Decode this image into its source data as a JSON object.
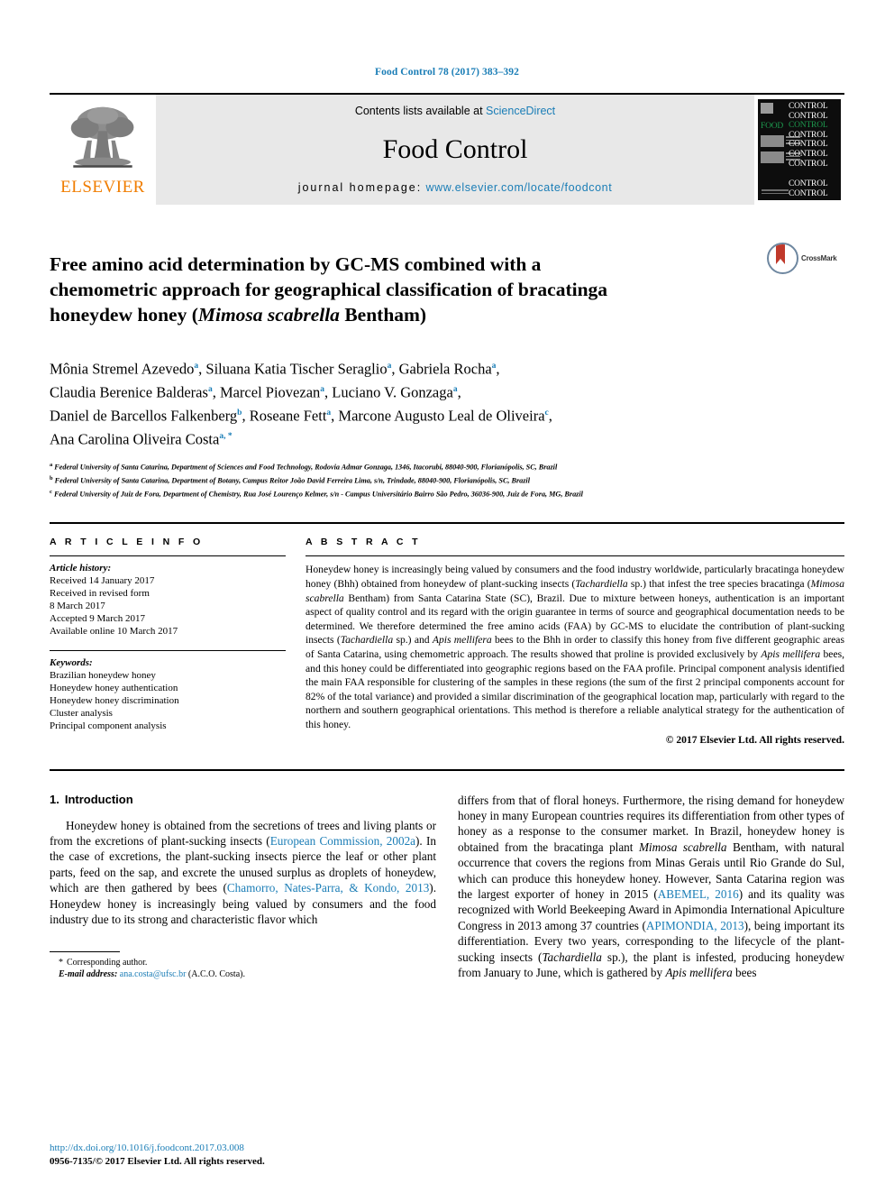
{
  "running_head": "Food Control 78 (2017) 383–392",
  "banner": {
    "publisher_name": "ELSEVIER",
    "publisher_logo_icon": "elsevier-tree-icon",
    "contents_prefix": "Contents lists available at",
    "contents_link": "ScienceDirect",
    "journal_name": "Food Control",
    "homepage_label": "journal homepage:",
    "homepage_url": "www.elsevier.com/locate/foodcont",
    "cover": {
      "repeat_word": "CONTROL",
      "accent_word": "FOOD",
      "accent_color": "#1d9a4e",
      "background": "#0d0d0d"
    }
  },
  "title": {
    "line1": "Free amino acid determination by GC-MS combined with a",
    "line2": "chemometric approach for geographical classification of bracatinga",
    "line3_pre": "honeydew honey (",
    "line3_italic": "Mimosa scabrella",
    "line3_post": " Bentham)"
  },
  "crossmark": {
    "label": "CrossMark",
    "icon": "crossmark-icon"
  },
  "authors": [
    {
      "name": "Mônia Stremel Azevedo",
      "sup": "a",
      "sep": ", "
    },
    {
      "name": "Siluana Katia Tischer Seraglio",
      "sup": "a",
      "sep": ", "
    },
    {
      "name": "Gabriela Rocha",
      "sup": "a",
      "sep": ","
    },
    {
      "name": "Claudia Berenice Balderas",
      "sup": "a",
      "sep": ", "
    },
    {
      "name": "Marcel Piovezan",
      "sup": "a",
      "sep": ", "
    },
    {
      "name": "Luciano V. Gonzaga",
      "sup": "a",
      "sep": ","
    },
    {
      "name": "Daniel de Barcellos Falkenberg",
      "sup": "b",
      "sep": ", "
    },
    {
      "name": "Roseane Fett",
      "sup": "a",
      "sep": ", "
    },
    {
      "name": "Marcone Augusto Leal de Oliveira",
      "sup": "c",
      "sep": ","
    },
    {
      "name": "Ana Carolina Oliveira Costa",
      "sup": "a, *",
      "sep": ""
    }
  ],
  "author_lines": [
    "Mônia Stremel Azevedo a, Siluana Katia Tischer Seraglio a, Gabriela Rocha a,",
    "Claudia Berenice Balderas a, Marcel Piovezan a, Luciano V. Gonzaga a,",
    "Daniel de Barcellos Falkenberg b, Roseane Fett a, Marcone Augusto Leal de Oliveira c,",
    "Ana Carolina Oliveira Costa a, *"
  ],
  "affiliations": [
    {
      "mark": "a",
      "text": "Federal University of Santa Catarina, Department of Sciences and Food Technology, Rodovia Admar Gonzaga, 1346, Itacorubi, 88040-900, Florianópolis, SC, Brazil"
    },
    {
      "mark": "b",
      "text": "Federal University of Santa Catarina, Department of Botany, Campus Reitor João David Ferreira Lima, s/n, Trindade, 88040-900, Florianópolis, SC, Brazil"
    },
    {
      "mark": "c",
      "text": "Federal University of Juiz de Fora, Department of Chemistry, Rua José Lourenço Kelmer, s/n - Campus Universitário Bairro São Pedro, 36036-900, Juiz de Fora, MG, Brazil"
    }
  ],
  "article_info": {
    "heading": "A R T I C L E  I N F O",
    "history_label": "Article history:",
    "history": [
      "Received 14 January 2017",
      "Received in revised form",
      "8 March 2017",
      "Accepted 9 March 2017",
      "Available online 10 March 2017"
    ],
    "keywords_label": "Keywords:",
    "keywords": [
      "Brazilian honeydew honey",
      "Honeydew honey authentication",
      "Honeydew honey discrimination",
      "Cluster analysis",
      "Principal component analysis"
    ]
  },
  "abstract": {
    "heading": "A B S T R A C T",
    "part1": "Honeydew honey is increasingly being valued by consumers and the food industry worldwide, particularly bracatinga honeydew honey (Bhh) obtained from honeydew of plant-sucking insects (",
    "sp1": "Tachardiella",
    "part2": " sp.) that infest the tree species bracatinga (",
    "sp2": "Mimosa scabrella",
    "part3": " Bentham) from Santa Catarina State (SC), Brazil. Due to mixture between honeys, authentication is an important aspect of quality control and its regard with the origin guarantee in terms of source and geographical documentation needs to be determined. We therefore determined the free amino acids (FAA) by GC-MS to elucidate the contribution of plant-sucking insects (",
    "sp3": "Tachardiella",
    "part4": " sp.) and ",
    "sp4": "Apis mellifera",
    "part5": " bees to the Bhh in order to classify this honey from five different geographic areas of Santa Catarina, using chemometric approach. The results showed that proline is provided exclusively by ",
    "sp5": "Apis mellifera",
    "part6": " bees, and this honey could be differentiated into geographic regions based on the FAA profile. Principal component analysis identified the main FAA responsible for clustering of the samples in these regions (the sum of the first 2 principal components account for 82% of the total variance) and provided a similar discrimination of the geographical location map, particularly with regard to the northern and southern geographical orientations. This method is therefore a reliable analytical strategy for the authentication of this honey.",
    "copyright": "© 2017 Elsevier Ltd. All rights reserved."
  },
  "intro": {
    "number": "1.",
    "heading": "Introduction",
    "left_p1_a": "Honeydew honey is obtained from the secretions of trees and living plants or from the excretions of plant-sucking insects (",
    "left_ref1": "European Commission, 2002a",
    "left_p1_b": "). In the case of excretions, the plant-sucking insects pierce the leaf or other plant parts, feed on the sap, and excrete the unused surplus as droplets of honeydew, which are then gathered by bees (",
    "left_ref2": "Chamorro, Nates-Parra, & Kondo, 2013",
    "left_p1_c": "). Honeydew honey is increasingly being valued by consumers and the food industry due to its strong and characteristic flavor which",
    "right_p1_a": "differs from that of floral honeys. Furthermore, the rising demand for honeydew honey in many European countries requires its differentiation from other types of honey as a response to the consumer market. In Brazil, honeydew honey is obtained from the bracatinga plant ",
    "right_sp1": "Mimosa scabrella",
    "right_p1_b": " Bentham, with natural occurrence that covers the regions from Minas Gerais until Rio Grande do Sul, which can produce this honeydew honey. However, Santa Catarina region was the largest exporter of honey in 2015 (",
    "right_ref1": "ABEMEL, 2016",
    "right_p1_c": ") and its quality was recognized with World Beekeeping Award in Apimondia International Apiculture Congress in 2013 among 37 countries (",
    "right_ref2": "APIMONDIA, 2013",
    "right_p1_d": "), being important its differentiation. Every two years, corresponding to the lifecycle of the plant-sucking insects (",
    "right_sp2": "Tachardiella",
    "right_p1_e": " sp.), the plant is infested, producing honeydew from January to June, which is gathered by ",
    "right_sp3": "Apis mellifera",
    "right_p1_f": " bees"
  },
  "footnote": {
    "star": "*",
    "corresponding": "Corresponding author.",
    "email_label": "E-mail address:",
    "email": "ana.costa@ufsc.br",
    "email_owner": "(A.C.O. Costa)."
  },
  "page_footer": {
    "doi": "http://dx.doi.org/10.1016/j.foodcont.2017.03.008",
    "issn_line": "0956-7135/© 2017 Elsevier Ltd. All rights reserved."
  },
  "colors": {
    "link": "#1a7db6",
    "elsevier_orange": "#f07d00",
    "cover_green": "#1d9a4e",
    "crossmark_red": "#c0392b"
  }
}
